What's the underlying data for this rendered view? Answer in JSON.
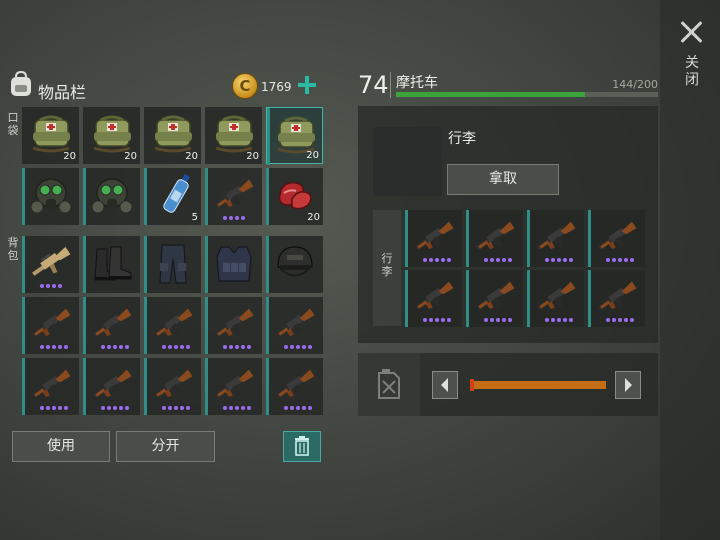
{
  "close": {
    "label": "关闭"
  },
  "inventory": {
    "title": "物品栏",
    "coins": "1769",
    "pocket_label": "口袋",
    "backpack_label": "背包",
    "pockets": [
      {
        "item": "medkit",
        "qty": "20"
      },
      {
        "item": "medkit",
        "qty": "20"
      },
      {
        "item": "medkit",
        "qty": "20"
      },
      {
        "item": "medkit",
        "qty": "20"
      },
      {
        "item": "medkit",
        "qty": "20",
        "selected": true
      },
      {
        "item": "gas-mask",
        "qty": ""
      },
      {
        "item": "gas-mask",
        "qty": ""
      },
      {
        "item": "water-bottle",
        "qty": "5"
      },
      {
        "item": "ak-rifle",
        "qty": "",
        "dots": 4
      },
      {
        "item": "raw-meat",
        "qty": "20"
      }
    ],
    "backpack": [
      {
        "item": "assault-rifle",
        "qty": "",
        "dots": 4
      },
      {
        "item": "boots",
        "qty": ""
      },
      {
        "item": "tactical-pants",
        "qty": ""
      },
      {
        "item": "tactical-vest",
        "qty": ""
      },
      {
        "item": "helmet",
        "qty": ""
      },
      {
        "item": "ak-rifle",
        "dots": 5
      },
      {
        "item": "ak-rifle",
        "dots": 5
      },
      {
        "item": "ak-rifle",
        "dots": 5
      },
      {
        "item": "ak-rifle",
        "dots": 5
      },
      {
        "item": "ak-rifle",
        "dots": 5
      },
      {
        "item": "ak-rifle",
        "dots": 5
      },
      {
        "item": "ak-rifle",
        "dots": 5
      },
      {
        "item": "ak-rifle",
        "dots": 5
      },
      {
        "item": "ak-rifle",
        "dots": 5
      },
      {
        "item": "ak-rifle",
        "dots": 5
      }
    ],
    "buttons": {
      "use": "使用",
      "split": "分开"
    }
  },
  "vehicle": {
    "level": "74",
    "name": "摩托车",
    "capacity": "144/200",
    "capacity_fraction": 0.72,
    "luggage_title": "行李",
    "take_label": "拿取",
    "luggage_label": "行李",
    "luggage": [
      {
        "item": "ak-rifle",
        "dots": 5
      },
      {
        "item": "ak-rifle",
        "dots": 5
      },
      {
        "item": "ak-rifle",
        "dots": 5
      },
      {
        "item": "ak-rifle",
        "dots": 5
      },
      {
        "item": "ak-rifle",
        "dots": 5
      },
      {
        "item": "ak-rifle",
        "dots": 5
      },
      {
        "item": "ak-rifle",
        "dots": 5
      },
      {
        "item": "ak-rifle",
        "dots": 5
      }
    ],
    "fuel_fraction": 1.0
  },
  "colors": {
    "accent": "#2bb9a3",
    "capacity_bar": "#3aa43a",
    "fuel_bar": "#c56d16",
    "rarity_dot": "#9b6cf0"
  }
}
